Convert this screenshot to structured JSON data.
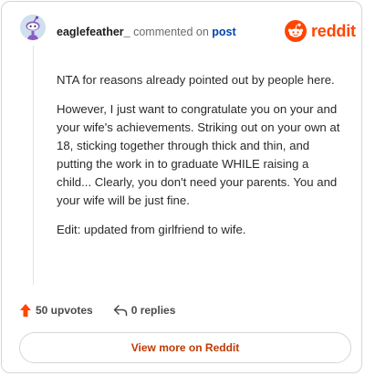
{
  "comment": {
    "username": "eaglefeather_",
    "commented_text": "commented on",
    "post_link_label": "post",
    "paragraphs": [
      "NTA for reasons already pointed out by people here.",
      "However, I just want to congratulate you on your and your wife's achievements. Striking out on your own at 18, sticking together through thick and thin, and putting the work in to graduate WHILE raising a child... Clearly, you don't need your parents. You and your wife will be just fine.",
      "Edit: updated from girlfriend to wife."
    ]
  },
  "brand": {
    "wordmark": "reddit",
    "color": "#ff4500",
    "icon": "reddit-alien-logo-icon"
  },
  "footer": {
    "upvotes_label": "50 upvotes",
    "replies_label": "0 replies",
    "upvote_icon": "upvote-arrow-icon",
    "reply_icon": "reply-arrow-icon",
    "upvote_color": "#ff4500"
  },
  "view_more": {
    "label": "View more on Reddit",
    "text_color": "#c13900"
  }
}
